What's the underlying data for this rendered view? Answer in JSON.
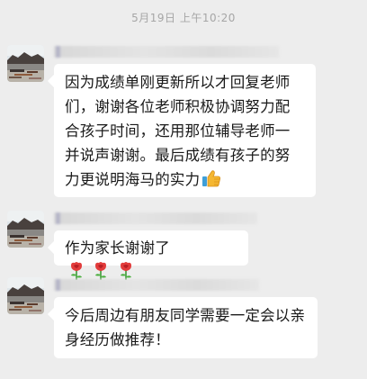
{
  "timestamp": "5月19日 上午10:20",
  "messages": [
    {
      "text": "因为成绩单刚更新所以才回复老师们，谢谢各位老师积极协调努力配合孩子时间，还用那位辅导老师一并说声谢谢。最后成绩有孩子的努力更说明海马的实力",
      "trailing_icon": "thumbs-up-icon"
    },
    {
      "text": "作为家长谢谢了",
      "trailing_icons": [
        "rose-icon",
        "rose-icon",
        "rose-icon"
      ]
    },
    {
      "text": "今后周边有朋友同学需要一定会以亲身经历做推荐！"
    }
  ],
  "colors": {
    "chat_background": "#ededed",
    "bubble_background": "#ffffff",
    "timestamp_text": "#a6a6a6",
    "message_text": "#191919"
  }
}
